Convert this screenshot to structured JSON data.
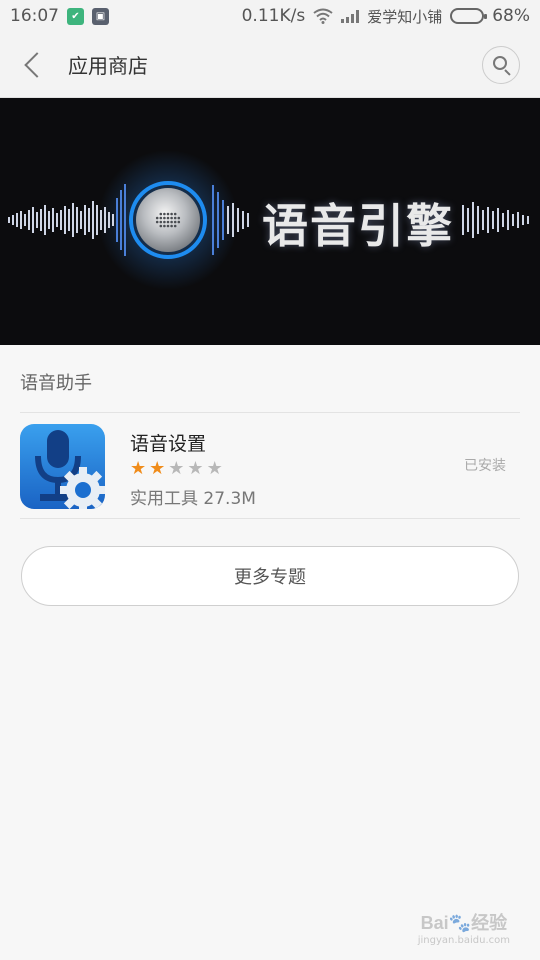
{
  "status_bar": {
    "time": "16:07",
    "net_speed": "0.11K/s",
    "carrier": "爱学知小铺",
    "battery": "68%",
    "battery_level": 0.68,
    "icons": [
      "shield-icon",
      "app-icon",
      "wifi-icon",
      "signal-icon",
      "battery-icon"
    ]
  },
  "header": {
    "title": "应用商店",
    "back_icon": "back-arrow-icon",
    "search_icon": "search-icon"
  },
  "banner": {
    "text": "语音引擎"
  },
  "section": {
    "title": "语音助手",
    "apps": [
      {
        "name": "语音设置",
        "rating": 2,
        "rating_max": 5,
        "meta": "实用工具 27.3M",
        "status": "已安装"
      }
    ]
  },
  "more_button": "更多专题",
  "colors": {
    "star_on": "#f08c1a",
    "star_off": "#b8b8b8",
    "banner_bg": "#0c0c0e",
    "accent_blue": "#2b8be0"
  }
}
